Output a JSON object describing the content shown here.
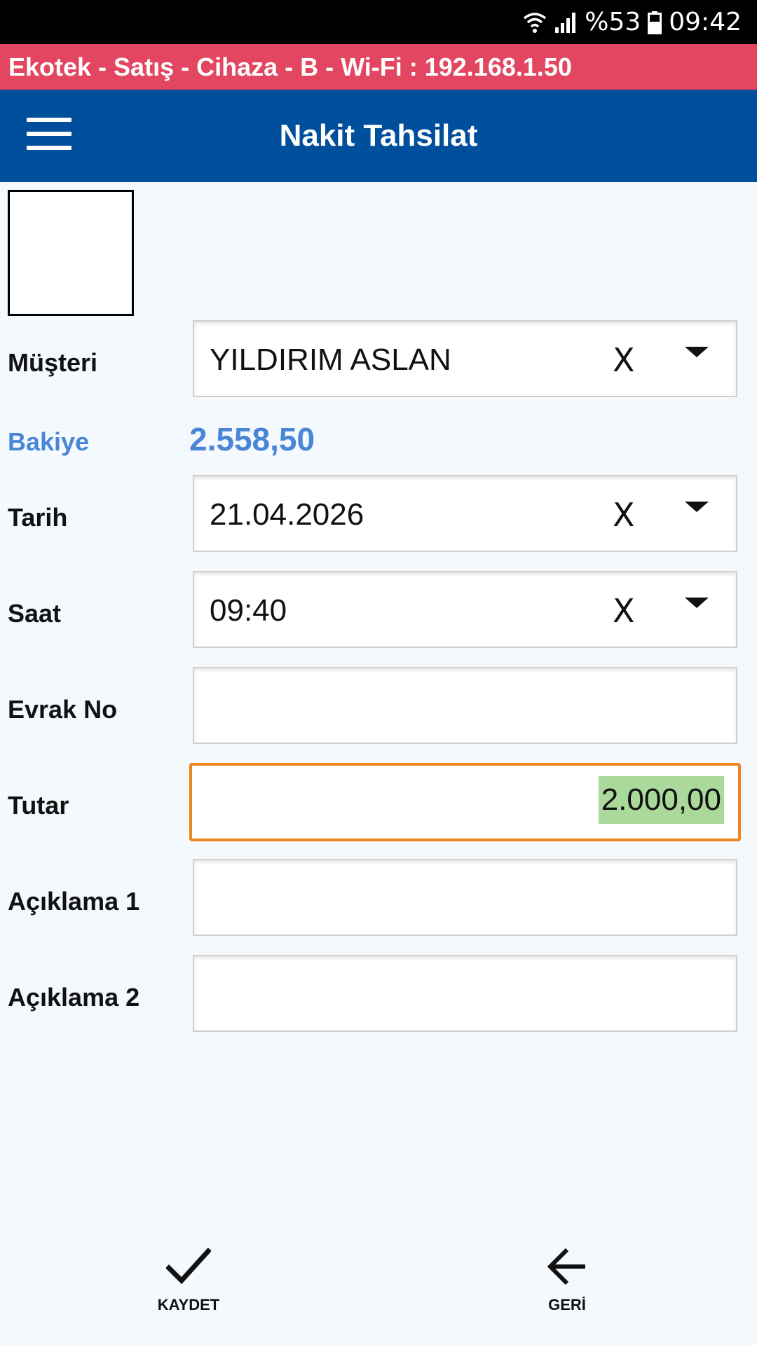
{
  "status_bar": {
    "battery": "%53",
    "time": "09:42"
  },
  "connection_bar": {
    "text": "Ekotek - Satış - Cihaza - B - Wi-Fi : 192.168.1.50"
  },
  "app_bar": {
    "title": "Nakit Tahsilat"
  },
  "form": {
    "customer": {
      "label": "Müşteri",
      "value": "YILDIRIM ASLAN",
      "clear": "X"
    },
    "balance": {
      "label": "Bakiye",
      "value": "2.558,50"
    },
    "date": {
      "label": "Tarih",
      "value": "21.04.2026",
      "clear": "X"
    },
    "time": {
      "label": "Saat",
      "value": "09:40",
      "clear": "X"
    },
    "document_no": {
      "label": "Evrak No",
      "value": ""
    },
    "amount": {
      "label": "Tutar",
      "value": "2.000,00"
    },
    "note1": {
      "label": "Açıklama 1",
      "value": ""
    },
    "note2": {
      "label": "Açıklama 2",
      "value": ""
    }
  },
  "actions": {
    "save_label": "KAYDET",
    "back_label": "GERİ"
  },
  "colors": {
    "status_bar": "#000000",
    "connection_bar": "#e34661",
    "app_bar": "#004f9c",
    "balance_text": "#4a86d8",
    "active_border": "#f08418",
    "selection_highlight": "#aad99b",
    "background": "#f4f9fd"
  },
  "icons": {
    "menu": "hamburger-icon",
    "wifi": "wifi-icon",
    "signal": "cellular-signal-icon",
    "battery": "battery-icon",
    "save": "checkmark-icon",
    "back": "arrow-left-icon",
    "dropdown": "dropdown-arrow-icon"
  }
}
